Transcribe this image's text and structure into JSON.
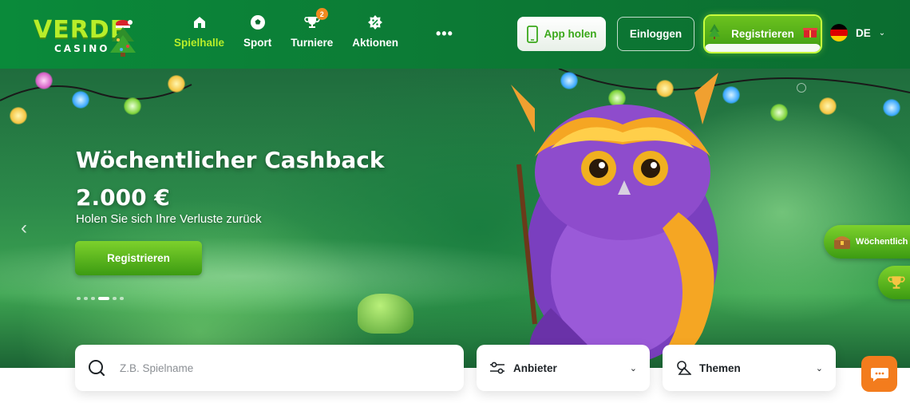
{
  "brand": {
    "name": "VERDE",
    "sub": "CASINO",
    "accent": "#b7ee2a",
    "header_bg": "#0a8a3a"
  },
  "nav": {
    "items": [
      {
        "label": "Spielhalle",
        "icon": "home-icon",
        "active": true
      },
      {
        "label": "Sport",
        "icon": "football-icon"
      },
      {
        "label": "Turniere",
        "icon": "trophy-icon",
        "badge": "2"
      },
      {
        "label": "Aktionen",
        "icon": "percent-badge-icon"
      }
    ],
    "more_label": "•••"
  },
  "header_actions": {
    "app_label": "App holen",
    "login_label": "Einloggen",
    "register_label": "Registrieren",
    "language": "DE"
  },
  "hero": {
    "title": "Wöchentlicher Cashback",
    "amount": "2.000 €",
    "subtitle": "Holen Sie sich Ihre Verluste zurück",
    "cta_label": "Registrieren",
    "slide_count": 6,
    "active_slide": 3
  },
  "side": {
    "weekly_label": "Wöchentlich"
  },
  "search": {
    "placeholder": "Z.B. Spielname",
    "provider_label": "Anbieter",
    "themes_label": "Themen"
  }
}
